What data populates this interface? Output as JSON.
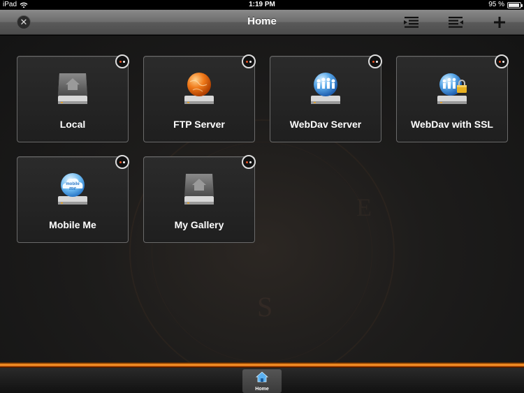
{
  "statusbar": {
    "device": "iPad",
    "time": "1:19 PM",
    "battery": "95 %"
  },
  "navbar": {
    "title": "Home"
  },
  "tiles": [
    {
      "label": "Local",
      "icon": "house-drive-icon"
    },
    {
      "label": "FTP Server",
      "icon": "globe-drive-icon"
    },
    {
      "label": "WebDav Server",
      "icon": "network-drive-icon"
    },
    {
      "label": "WebDav with SSL",
      "icon": "secure-network-drive-icon"
    },
    {
      "label": "Mobile Me",
      "icon": "mobileme-drive-icon"
    },
    {
      "label": "My Gallery",
      "icon": "house-drive-icon"
    }
  ],
  "tabbar": {
    "home_label": "Home"
  }
}
